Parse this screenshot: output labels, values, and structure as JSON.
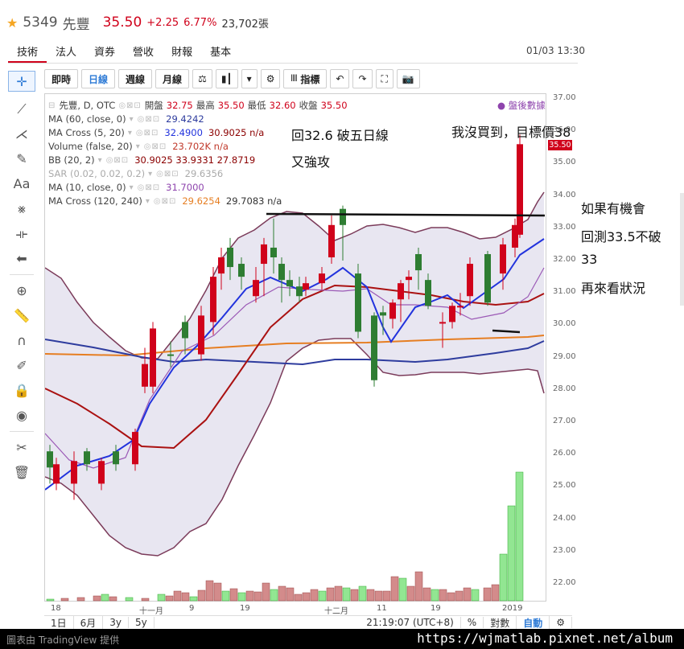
{
  "header": {
    "code": "5349",
    "name": "先豐",
    "price": "35.50",
    "change": "+2.25",
    "percent": "6.77%",
    "volume": "23,702張"
  },
  "tabs": [
    "技術",
    "法人",
    "資券",
    "營收",
    "財報",
    "基本"
  ],
  "datetime": "01/03 13:30",
  "toolbar": {
    "buttons": [
      "即時",
      "日線",
      "週線",
      "月線"
    ],
    "indicator_label": "指標"
  },
  "legend": {
    "title_row": {
      "name": "先豐, D, OTC",
      "open_label": "開盤",
      "open": "32.75",
      "high_label": "最高",
      "high": "35.50",
      "low_label": "最低",
      "low": "32.60",
      "close_label": "收盤",
      "close": "35.50"
    },
    "rows": [
      {
        "name": "MA (60, close, 0)",
        "values": "29.4242",
        "color": "#2e3c9e"
      },
      {
        "name": "MA Cross (5, 20)",
        "values": "32.4900",
        "values2": "30.9025 n/a",
        "color": "#2233dd",
        "color2": "#8b0000"
      },
      {
        "name": "Volume (false, 20)",
        "values": "23.702K n/a",
        "color": "#c0392b"
      },
      {
        "name": "BB (20, 2)",
        "values": "30.9025 33.9331 27.8719",
        "color": "#8b0000"
      },
      {
        "name": "SAR (0.02, 0.02, 0.2)",
        "values": "29.6356",
        "color": "#aaaaaa"
      },
      {
        "name": "MA (10, close, 0)",
        "values": "31.7000",
        "color": "#8e44ad"
      },
      {
        "name": "MA Cross (120, 240)",
        "values": "29.6254",
        "values2": "29.7083 n/a",
        "color": "#e67e22",
        "color2": "#333333"
      }
    ],
    "post_market": "盤後數據"
  },
  "annotations": {
    "a1": "回32.6 破五日線",
    "a2": "又強攻",
    "a3": "我沒買到，目標價38",
    "a4": "如果有機會",
    "a5": "回測33.5不破",
    "a6": "33",
    "a7": "再來看狀況"
  },
  "price_axis": [
    "37.00",
    "36.00",
    "35.00",
    "34.00",
    "33.00",
    "32.00",
    "31.00",
    "30.00",
    "29.00",
    "28.00",
    "27.00",
    "26.00",
    "25.00",
    "24.00",
    "23.00",
    "22.00"
  ],
  "price_tag": "35.50",
  "x_axis": [
    "18",
    "十一月",
    "9",
    "19",
    "十二月",
    "11",
    "19",
    "2019"
  ],
  "status": {
    "ranges": [
      "1日",
      "6月",
      "3y",
      "5y"
    ],
    "time": "21:19:07 (UTC+8)",
    "pct": "%",
    "log": "對數",
    "auto": "自動"
  },
  "footer": {
    "left": "圖表由 TradingView 提供",
    "url": "https://wjmatlab.pixnet.net/album"
  },
  "colors": {
    "up": "#d0021b",
    "down": "#2e7d32",
    "bb": "#7b3b5a",
    "ma5": "#2233dd",
    "ma20": "#aa1111"
  }
}
